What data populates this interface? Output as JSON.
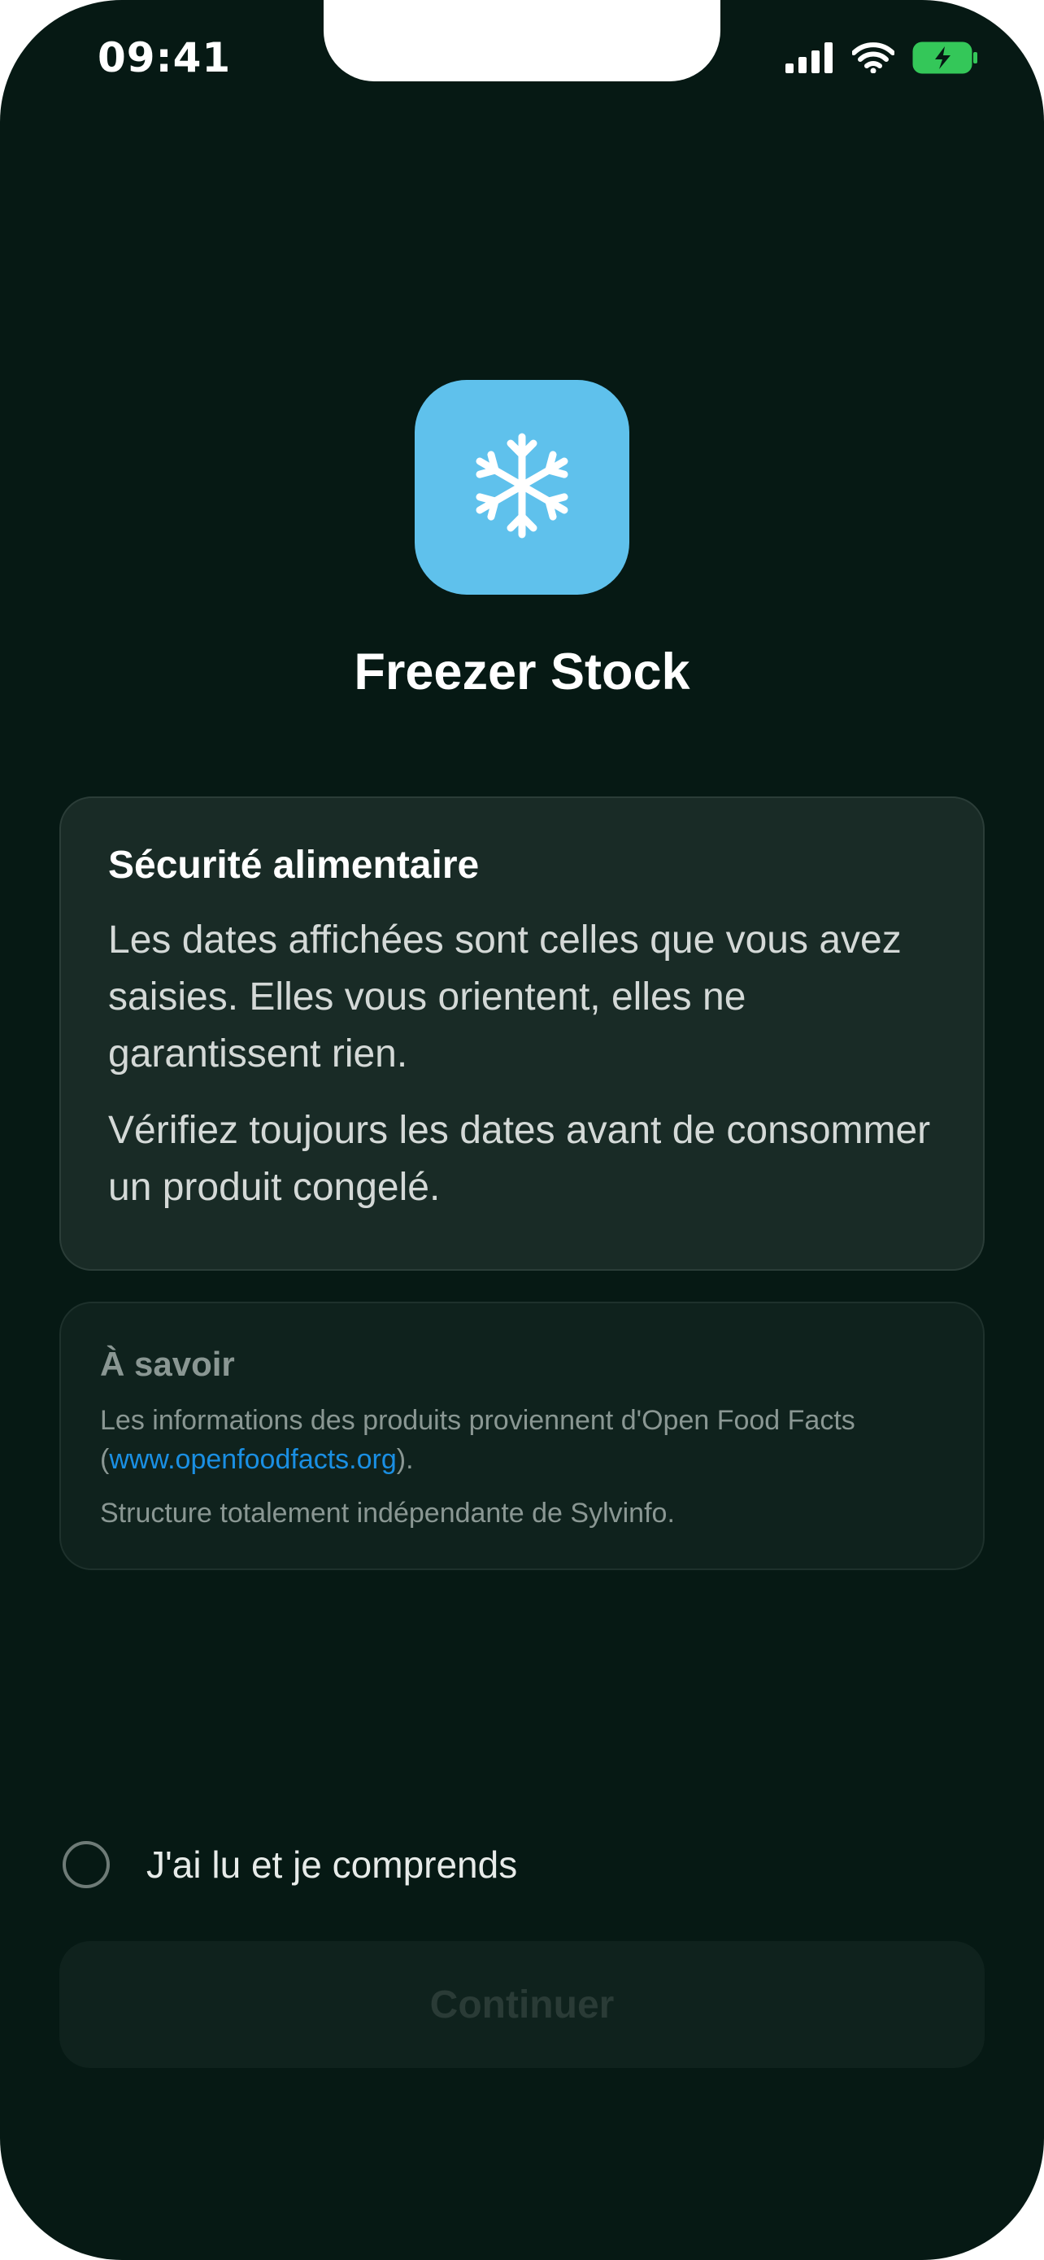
{
  "status_bar": {
    "time": "09:41",
    "icons": [
      "cellular-signal-icon",
      "wifi-icon",
      "battery-charging-icon"
    ],
    "battery_color": "#34c759"
  },
  "app": {
    "icon": "snowflake-icon",
    "icon_color": "#5fc1ec",
    "title": "Freezer Stock"
  },
  "safety_card": {
    "title": "Sécurité alimentaire",
    "paragraph1": "Les dates affichées sont celles que vous avez saisies. Elles vous orientent, elles ne garantissent rien.",
    "paragraph2": "Vérifiez toujours les dates avant de consommer un produit congelé."
  },
  "info_card": {
    "title": "À savoir",
    "source_prefix": "Les informations des produits proviennent d'Open Food Facts (",
    "source_link": "www.openfoodfacts.org",
    "source_suffix": ").",
    "independence_text": "Structure totalement indépendante de Sylvinfo.",
    "link_color": "#1a8fe3"
  },
  "agreement": {
    "label": "J'ai lu et je comprends",
    "checked": false
  },
  "actions": {
    "continue_label": "Continuer",
    "continue_enabled": false
  }
}
